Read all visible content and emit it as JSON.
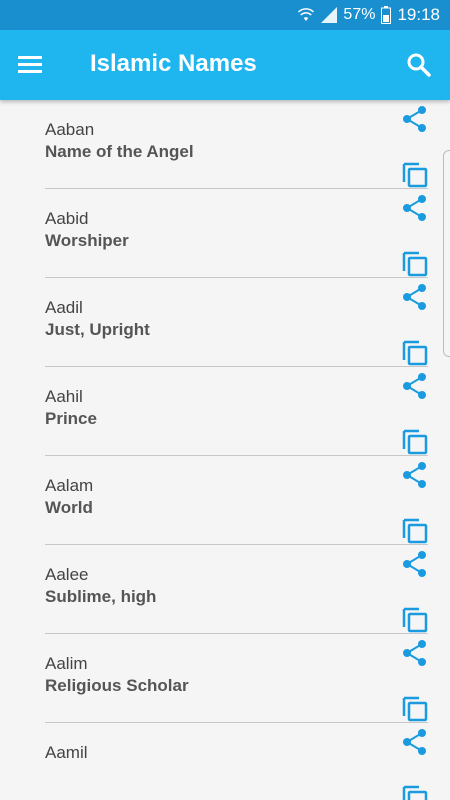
{
  "status_bar": {
    "battery": "57%",
    "time": "19:18"
  },
  "app_bar": {
    "title": "Islamic Names"
  },
  "colors": {
    "accent": "#1fb5ef",
    "icon": "#1a9be0"
  },
  "items": [
    {
      "name": "Aaban",
      "meaning": "Name of the Angel"
    },
    {
      "name": "Aabid",
      "meaning": "Worshiper"
    },
    {
      "name": "Aadil",
      "meaning": "Just, Upright"
    },
    {
      "name": "Aahil",
      "meaning": "Prince"
    },
    {
      "name": "Aalam",
      "meaning": "World"
    },
    {
      "name": "Aalee",
      "meaning": "Sublime, high"
    },
    {
      "name": "Aalim",
      "meaning": "Religious Scholar"
    },
    {
      "name": "Aamil",
      "meaning": ""
    }
  ]
}
